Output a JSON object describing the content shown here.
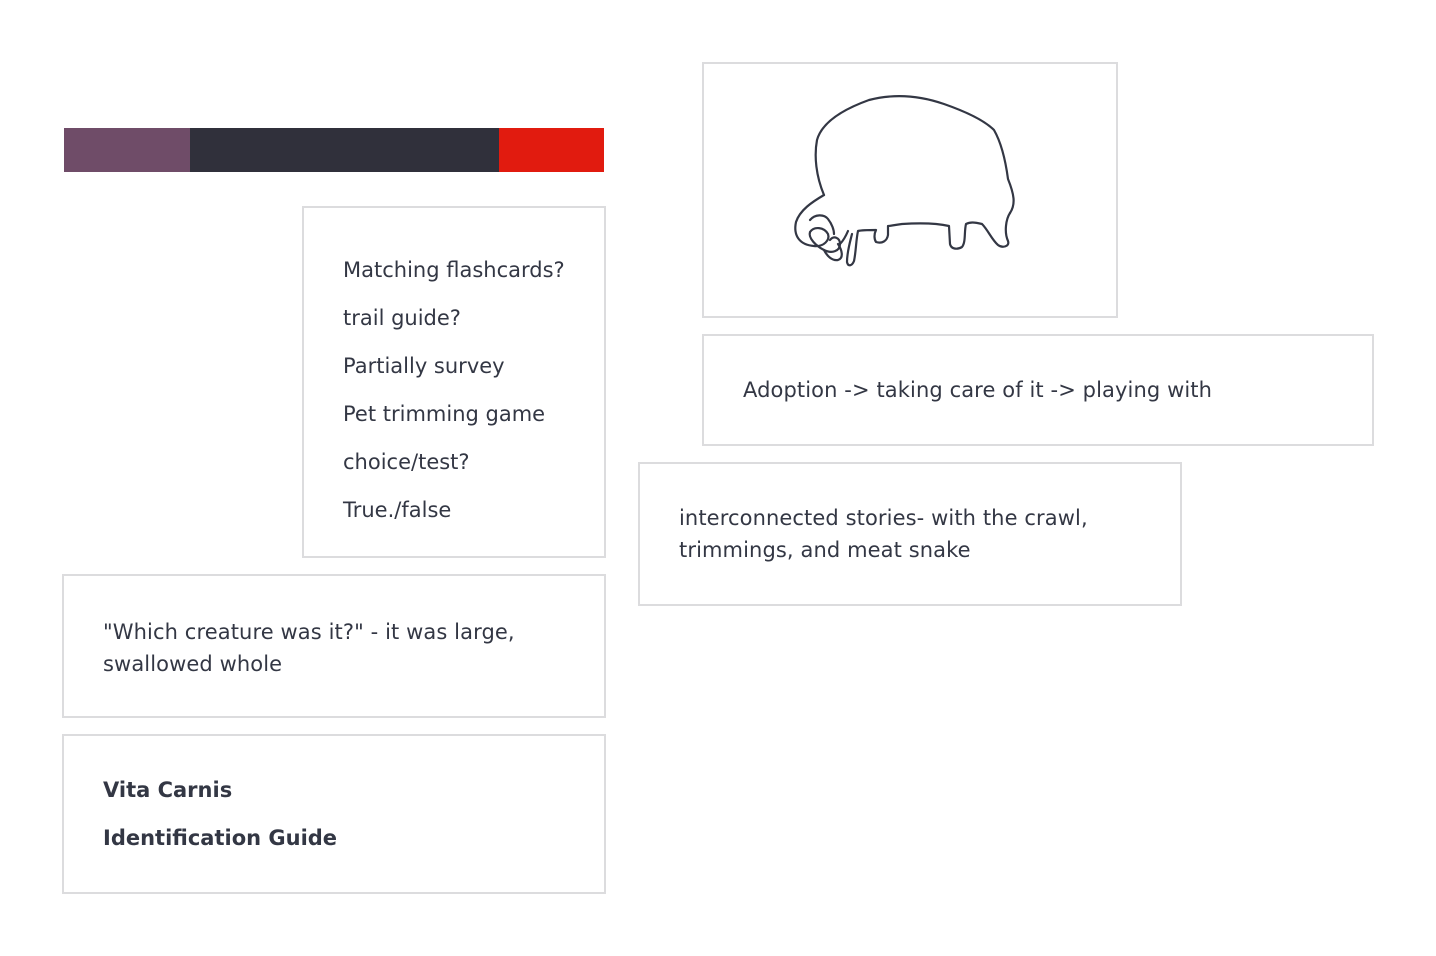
{
  "palette": {
    "colors": [
      {
        "name": "mauve",
        "hex": "#6f4c68",
        "fraction": 0.2333
      },
      {
        "name": "charcoal",
        "hex": "#30303b",
        "fraction": 0.5722
      },
      {
        "name": "red",
        "hex": "#e11b0f",
        "fraction": 0.1945
      }
    ]
  },
  "ideas_list": {
    "items": [
      "Matching flashcards?",
      "trail guide?",
      "Partially survey",
      "Pet trimming game",
      "choice/test?",
      "True./false"
    ]
  },
  "sketch": {
    "subject": "creature-sketch"
  },
  "notes": {
    "adoption_flow": "Adoption -> taking care of it -> playing with",
    "interconnected": "interconnected stories- with the crawl, trimmings, and meat snake",
    "which_creature": "\"Which creature was it?\" - it was large, swallowed whole"
  },
  "title_card": {
    "title": "Vita Carnis",
    "subtitle": "Identification Guide"
  },
  "colors": {
    "text": "#333744",
    "border": "#dcdcde",
    "background": "#ffffff"
  }
}
